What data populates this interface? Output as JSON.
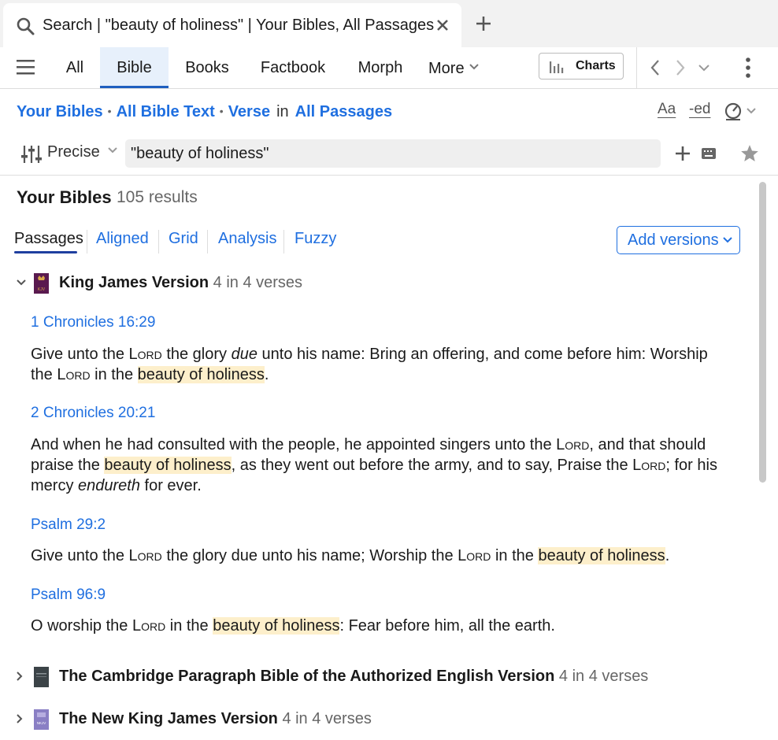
{
  "tab": {
    "title": "Search | \"beauty of holiness\" | Your Bibles, All Passages"
  },
  "toolbar": {
    "tabs": [
      "All",
      "Bible",
      "Books",
      "Factbook",
      "Morph"
    ],
    "more": "More",
    "charts": "Charts"
  },
  "breadcrumb": {
    "your_bibles": "Your Bibles",
    "all_bible_text": "All Bible Text",
    "verse": "Verse",
    "in": "in",
    "all_passages": "All Passages",
    "dot": "•",
    "aa": "Aa",
    "ed": "-ed"
  },
  "search": {
    "mode": "Precise",
    "query": "\"beauty of holiness\""
  },
  "results": {
    "heading": "Your Bibles",
    "count": "105 results"
  },
  "view_tabs": [
    "Passages",
    "Aligned",
    "Grid",
    "Analysis",
    "Fuzzy"
  ],
  "add_versions": "Add versions",
  "groups": [
    {
      "name": "King James Version",
      "count": "4 in 4 verses",
      "cover_text": "KJV"
    },
    {
      "name": "The Cambridge Paragraph Bible of the Authorized English Version",
      "count": "4 in 4 verses"
    },
    {
      "name": "The New King James Version",
      "count": "4 in 4 verses",
      "cover_text": "NKJV"
    }
  ],
  "passages": [
    {
      "ref": "1 Chronicles 16:29",
      "t1": "Give unto the ",
      "lord1": "Lord",
      "t2": " the glory ",
      "it1": "due",
      "t3": " unto his name: Bring an offering, and come before him: Worship the ",
      "lord2": "Lord",
      "t4": " in the ",
      "hl": "beauty of holiness",
      "t5": "."
    },
    {
      "ref": "2 Chronicles 20:21",
      "t1": "And when he had consulted with the people, he appointed singers unto the ",
      "lord1": "Lord",
      "t2": ", and that should praise the ",
      "hl": "beauty of holiness",
      "t3": ", as they went out before the army, and to say, Praise the ",
      "lord2": "Lord",
      "t4": "; for his mercy ",
      "it1": "endureth",
      "t5": " for ever."
    },
    {
      "ref": "Psalm 29:2",
      "t1": "Give unto the ",
      "lord1": "Lord",
      "t2": " the glory due unto his name; Worship the ",
      "lord2": "Lord",
      "t3": " in the ",
      "hl": "beauty of holiness",
      "t4": "."
    },
    {
      "ref": "Psalm 96:9",
      "t1": "O worship the ",
      "lord1": "Lord",
      "t2": " in the ",
      "hl": "beauty of holiness",
      "t3": ": Fear before him, all the earth."
    }
  ],
  "colors": {
    "accent": "#1f6fe0",
    "highlight": "#fdefcb",
    "active_tab_bg": "#e7f0fb"
  }
}
